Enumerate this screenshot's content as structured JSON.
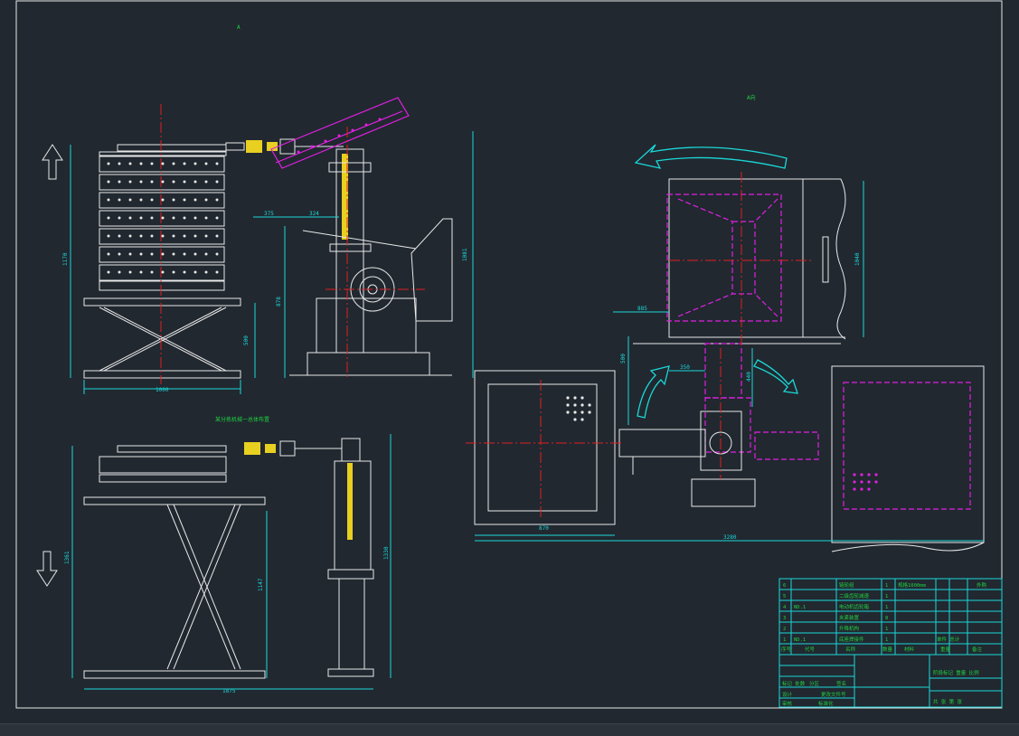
{
  "colors": {
    "background": "#212830",
    "white": "#e8e8e8",
    "cyan": "#1bd7d7",
    "magenta": "#e020e0",
    "red": "#e02020",
    "yellow": "#e8d020",
    "green": "#20d040",
    "grey": "#9a9a9a"
  },
  "labels": {
    "view_a_top": "A",
    "view_a_right": "A向",
    "front_view_caption": "某分拣机械一总体布置",
    "dim_1000": "1000",
    "dim_1875": "1875",
    "dim_1170": "1170",
    "dim_500": "500",
    "dim_1361": "1361",
    "dim_1147": "1147",
    "dim_375": "375",
    "dim_324": "324",
    "dim_878": "878",
    "dim_1081": "1081",
    "dim_1330": "1330",
    "dim_1040": "1040",
    "dim_885": "885",
    "dim_500b": "500",
    "dim_350": "350",
    "dim_440": "440",
    "dim_870": "870",
    "dim_3280": "3280"
  },
  "bom": {
    "rows": [
      {
        "no": "6",
        "code": "",
        "name": "链轮组",
        "qty": "1",
        "material": "规格1000mm",
        "note": "外购"
      },
      {
        "no": "5",
        "code": "",
        "name": "二级齿轮减速",
        "qty": "1",
        "material": "",
        "note": ""
      },
      {
        "no": "4",
        "code": "ND.1",
        "name": "电动机齿轮箱",
        "qty": "1",
        "material": "",
        "note": ""
      },
      {
        "no": "3",
        "code": "",
        "name": "夹紧装置",
        "qty": "8",
        "material": "",
        "note": ""
      },
      {
        "no": "2",
        "code": "",
        "name": "升降机构",
        "qty": "1",
        "material": "",
        "note": ""
      },
      {
        "no": "1",
        "code": "ND.1",
        "name": "底座焊接件",
        "qty": "1",
        "material": "",
        "note": ""
      }
    ],
    "header": {
      "no": "序号",
      "code": "代号",
      "name": "名称",
      "qty": "数量",
      "material": "材料",
      "weight": "单件 总计",
      "weight2": "重量",
      "note": "备注"
    }
  },
  "titleblock": {
    "rows": [
      "标记 处数",
      "设计",
      "审核",
      "工艺"
    ],
    "cols": [
      "分区",
      "更改文件号",
      "签名",
      "年月日"
    ],
    "mid": [
      "标准化",
      "批准"
    ],
    "right_top": "阶段标记 重量 比例",
    "right_bottom": "共 张 第 张"
  }
}
